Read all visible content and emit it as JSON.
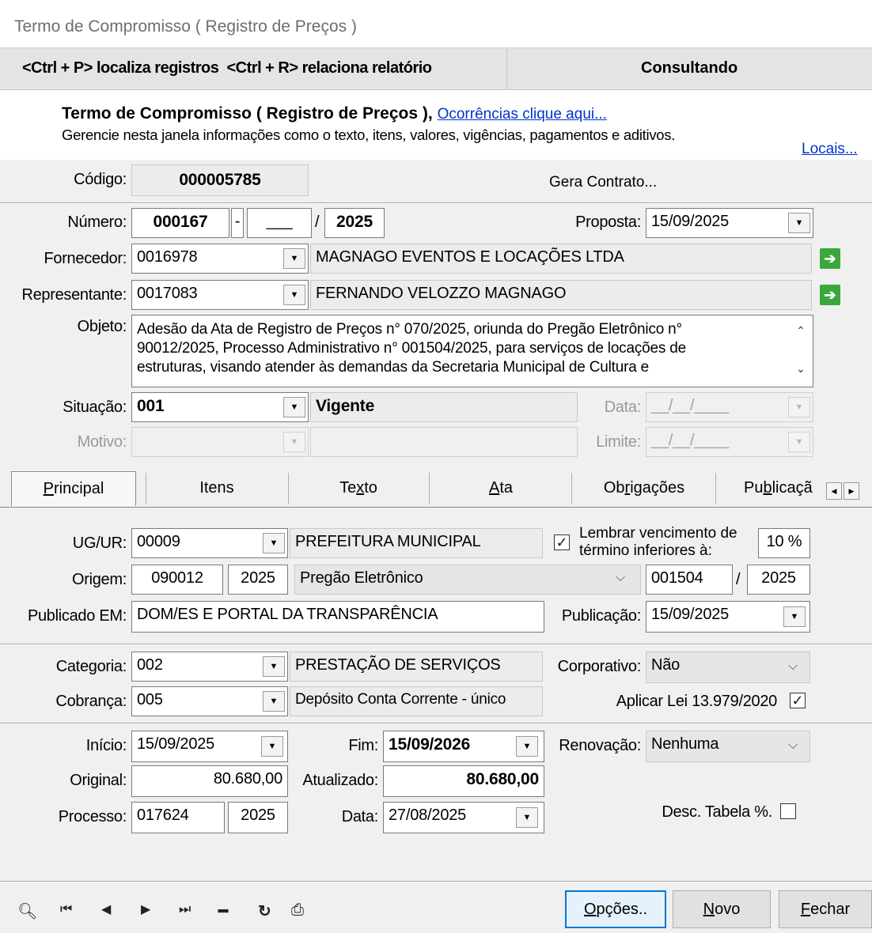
{
  "window": {
    "title": "Termo de Compromisso ( Registro de Preços )"
  },
  "hintbar": {
    "hint": "<Ctrl + P> localiza registros  <Ctrl + R> relaciona relatório",
    "mode": "Consultando"
  },
  "header": {
    "title": "Termo de Compromisso ( Registro de Preços ),",
    "link": "Ocorrências clique aqui...",
    "description": "Gerencie nesta janela informações como o texto, itens, valores, vigências, pagamentos e aditivos.",
    "locais": "Locais..."
  },
  "codigo": {
    "label": "Código:",
    "value": "000005785",
    "gera_contrato": "Gera Contrato..."
  },
  "numero": {
    "label": "Número:",
    "value": "000167",
    "dash": "-",
    "suffix": "___",
    "slash": "/",
    "year": "2025"
  },
  "proposta": {
    "label": "Proposta:",
    "value": "15/09/2025"
  },
  "fornecedor": {
    "label": "Fornecedor:",
    "code": "0016978",
    "name": "MAGNAGO EVENTOS E LOCAÇÕES LTDA"
  },
  "representante": {
    "label": "Representante:",
    "code": "0017083",
    "name": "FERNANDO VELOZZO MAGNAGO"
  },
  "objeto": {
    "label": "Objeto:",
    "lines": [
      "Adesão da Ata de Registro de Preços n° 070/2025, oriunda do Pregão Eletrônico n°",
      "90012/2025, Processo Administrativo n° 001504/2025, para serviços de locações de",
      "estruturas, visando atender às demandas da Secretaria Municipal de Cultura e"
    ]
  },
  "situacao": {
    "label": "Situação:",
    "code": "001",
    "desc": "Vigente"
  },
  "data_field": {
    "label": "Data:",
    "value": "__/__/____"
  },
  "motivo": {
    "label": "Motivo:"
  },
  "limite": {
    "label": "Limite:",
    "value": "__/__/____"
  },
  "tabs": [
    {
      "label": "Principal",
      "accesskey": "P"
    },
    {
      "label": "Itens"
    },
    {
      "label": "Texto"
    },
    {
      "label": "Ata"
    },
    {
      "label": "Obrigações"
    },
    {
      "label": "Publicaçã"
    }
  ],
  "ug": {
    "label": "UG/UR:",
    "code": "00009",
    "name": "PREFEITURA MUNICIPAL"
  },
  "lembrar": {
    "line1": "Lembrar vencimento de",
    "line2": "término inferiores à:",
    "value": "10 %"
  },
  "origem": {
    "label": "Origem:",
    "number": "090012",
    "year": "2025",
    "modalidade": "Pregão Eletrônico",
    "proc": "001504",
    "slash": "/",
    "proc_year": "2025"
  },
  "publicado": {
    "label": "Publicado EM:",
    "value": "DOM/ES E PORTAL DA TRANSPARÊNCIA"
  },
  "publicacao": {
    "label": "Publicação:",
    "value": "15/09/2025"
  },
  "categoria": {
    "label": "Categoria:",
    "code": "002",
    "name": "PRESTAÇÃO DE SERVIÇOS"
  },
  "corporativo": {
    "label": "Corporativo:",
    "value": "Não"
  },
  "cobranca": {
    "label": "Cobrança:",
    "code": "005",
    "name": "Depósito Conta Corrente - único"
  },
  "lei": {
    "label": "Aplicar Lei 13.979/2020"
  },
  "inicio": {
    "label": "Início:",
    "value": "15/09/2025"
  },
  "fim": {
    "label": "Fim:",
    "value": "15/09/2026"
  },
  "renovacao": {
    "label": "Renovação:",
    "value": "Nenhuma"
  },
  "original": {
    "label": "Original:",
    "value": "80.680,00"
  },
  "atualizado": {
    "label": "Atualizado:",
    "value": "80.680,00"
  },
  "processo": {
    "label": "Processo:",
    "number": "017624",
    "year": "2025"
  },
  "data_proc": {
    "label": "Data:",
    "value": "27/08/2025"
  },
  "desc_tabela": {
    "label": "Desc. Tabela %."
  },
  "buttons": {
    "opcoes": "Opções..",
    "novo": "Novo",
    "fechar": "Fechar"
  }
}
